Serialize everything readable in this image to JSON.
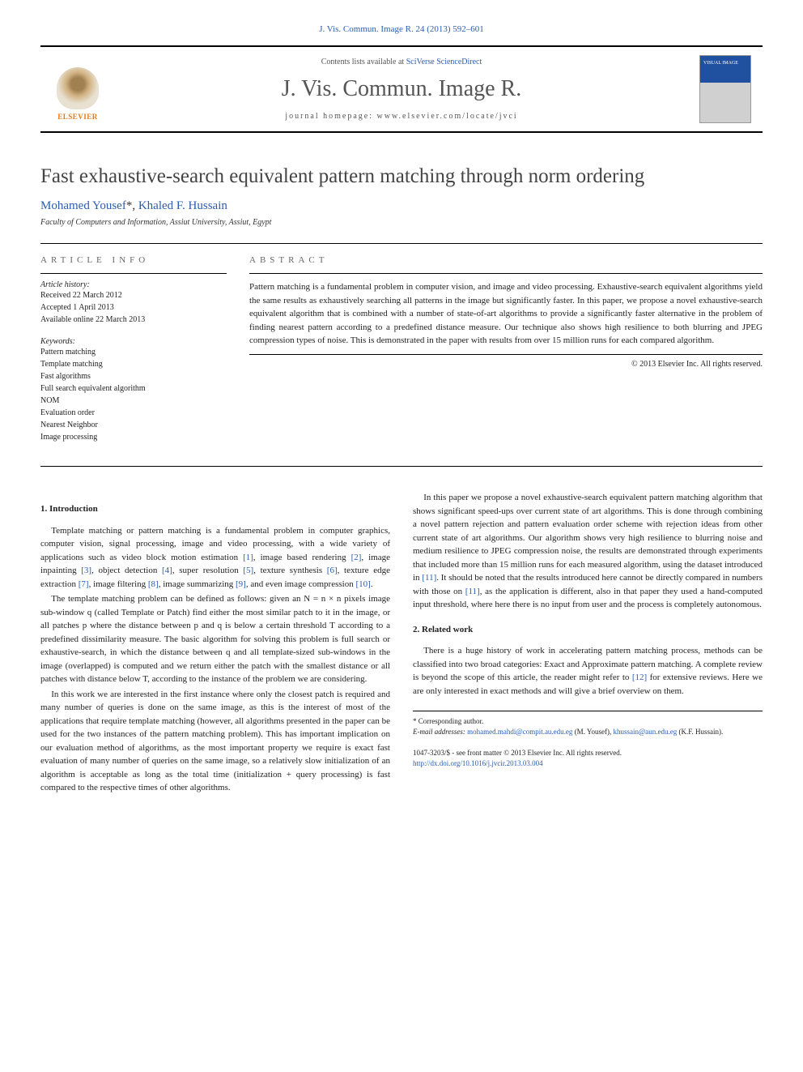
{
  "header": {
    "citation": "J. Vis. Commun. Image R. 24 (2013) 592–601",
    "contents_prefix": "Contents lists available at ",
    "contents_link": "SciVerse ScienceDirect",
    "journal_title": "J. Vis. Commun. Image R.",
    "homepage_label": "journal homepage: www.elsevier.com/locate/jvci",
    "publisher": "ELSEVIER"
  },
  "paper": {
    "title": "Fast exhaustive-search equivalent pattern matching through norm ordering",
    "authors_html": "Mohamed Yousef *, Khaled F. Hussain",
    "author1": "Mohamed Yousef",
    "author_mark": "*",
    "author_sep": ", ",
    "author2": "Khaled F. Hussain",
    "affiliation": "Faculty of Computers and Information, Assiut University, Assiut, Egypt"
  },
  "info": {
    "heading": "ARTICLE INFO",
    "history_label": "Article history:",
    "received": "Received 22 March 2012",
    "accepted": "Accepted 1 April 2013",
    "online": "Available online 22 March 2013",
    "keywords_label": "Keywords:",
    "keywords": [
      "Pattern matching",
      "Template matching",
      "Fast algorithms",
      "Full search equivalent algorithm",
      "NOM",
      "Evaluation order",
      "Nearest Neighbor",
      "Image processing"
    ]
  },
  "abstract": {
    "heading": "ABSTRACT",
    "text": "Pattern matching is a fundamental problem in computer vision, and image and video processing. Exhaustive-search equivalent algorithms yield the same results as exhaustively searching all patterns in the image but significantly faster. In this paper, we propose a novel exhaustive-search equivalent algorithm that is combined with a number of state-of-art algorithms to provide a significantly faster alternative in the problem of finding nearest pattern according to a predefined distance measure. Our technique also shows high resilience to both blurring and JPEG compression types of noise. This is demonstrated in the paper with results from over 15 million runs for each compared algorithm.",
    "copyright": "© 2013 Elsevier Inc. All rights reserved."
  },
  "sections": {
    "s1_title": "1. Introduction",
    "s1_p1a": "Template matching or pattern matching is a fundamental problem in computer graphics, computer vision, signal processing, image and video processing, with a wide variety of applications such as video block motion estimation ",
    "s1_p1b": ", image based rendering ",
    "s1_p1c": ", image inpainting ",
    "s1_p1d": ", object detection ",
    "s1_p1e": ", super resolution ",
    "s1_p1f": ", texture synthesis ",
    "s1_p1g": ", texture edge extraction ",
    "s1_p1h": ", image filtering ",
    "s1_p1i": ", image summarizing ",
    "s1_p1j": ", and even image compression ",
    "s1_p1k": ".",
    "s1_p2": "The template matching problem can be defined as follows: given an N = n × n pixels image sub-window q (called Template or Patch) find either the most similar patch to it in the image, or all patches p where the distance between p and q is below a certain threshold T according to a predefined dissimilarity measure. The basic algorithm for solving this problem is full search or exhaustive-search, in which the distance between q and all template-sized sub-windows in the image (overlapped) is computed and we return either the patch with the smallest distance or all patches with distance below T, according to the instance of the problem we are considering.",
    "s1_p3": "In this work we are interested in the first instance where only the closest patch is required and many number of queries is done on the same image, as this is the interest of most of the applications that require template matching (however, all algorithms presented in the paper can be used for the two instances of the pattern matching problem). This has important implication on our evaluation method of algorithms, as the most important property we require is exact fast evaluation of many number of queries on the same image, so a relatively slow initialization of an algorithm is acceptable as long as the total time (initialization + query processing) is fast compared to the respective times of other algorithms.",
    "s1_p4a": "In this paper we propose a novel exhaustive-search equivalent pattern matching algorithm that shows significant speed-ups over current state of art algorithms. This is done through combining a novel pattern rejection and pattern evaluation order scheme with rejection ideas from other current state of art algorithms. Our algorithm shows very high resilience to blurring noise and medium resilience to JPEG compression noise, the results are demonstrated through experiments that included more than 15 million runs for each measured algorithm, using the dataset introduced in ",
    "s1_p4b": ". It should be noted that the results introduced here cannot be directly compared in numbers with those on ",
    "s1_p4c": ", as the application is different, also in that paper they used a hand-computed input threshold, where here there is no input from user and the process is completely autonomous.",
    "s2_title": "2. Related work",
    "s2_p1a": "There is a huge history of work in accelerating pattern matching process, methods can be classified into two broad categories: Exact and Approximate pattern matching. A complete review is beyond the scope of this article, the reader might refer to ",
    "s2_p1b": " for extensive reviews. Here we are only interested in exact methods and will give a brief overview on them."
  },
  "refs": {
    "r1": "[1]",
    "r2": "[2]",
    "r3": "[3]",
    "r4": "[4]",
    "r5": "[5]",
    "r6": "[6]",
    "r7": "[7]",
    "r8": "[8]",
    "r9": "[9]",
    "r10": "[10]",
    "r11": "[11]",
    "r12": "[12]"
  },
  "footnotes": {
    "corr": "* Corresponding author.",
    "email_label": "E-mail addresses: ",
    "email1": "mohamed.mahdi@compit.au.edu.eg",
    "email1_who": " (M. Yousef), ",
    "email2": "khussain@aun.edu.eg",
    "email2_who": " (K.F. Hussain)."
  },
  "footer": {
    "issn": "1047-3203/$ - see front matter © 2013 Elsevier Inc. All rights reserved.",
    "doi": "http://dx.doi.org/10.1016/j.jvcir.2013.03.004"
  }
}
